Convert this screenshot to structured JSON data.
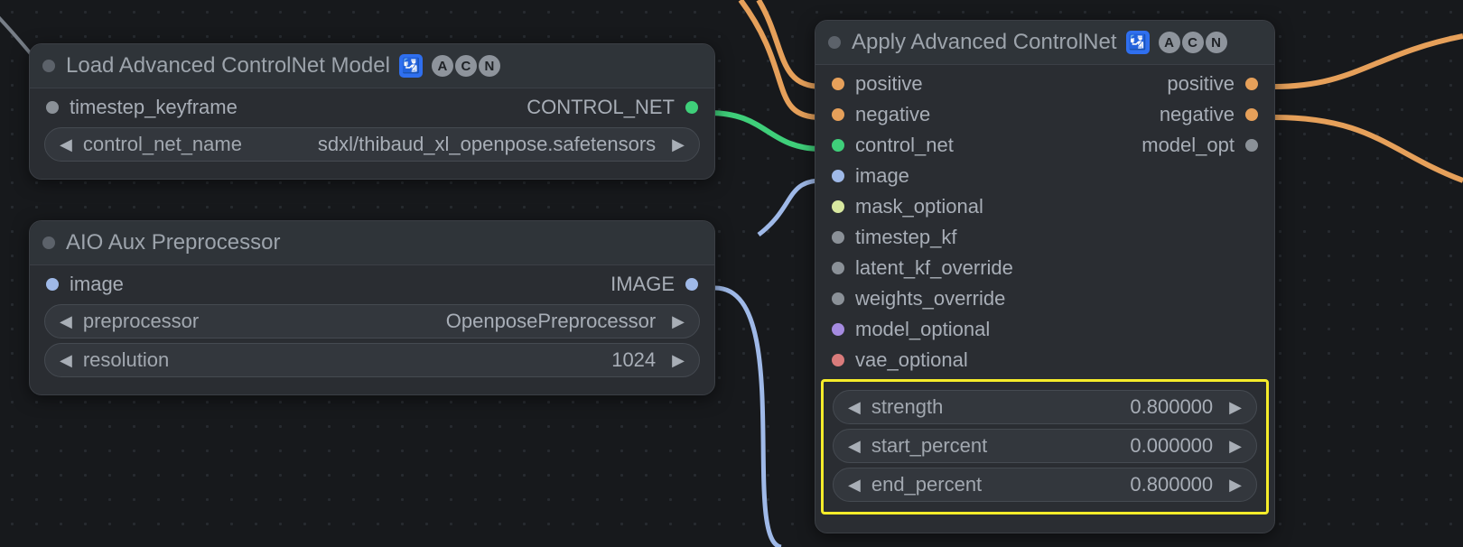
{
  "nodes": {
    "load_acn": {
      "title": "Load Advanced ControlNet Model",
      "badge_glyph": "🛂",
      "acn_letters": [
        "A",
        "C",
        "N"
      ],
      "inputs": {
        "timestep_keyframe": "timestep_keyframe"
      },
      "outputs": {
        "control_net": "CONTROL_NET"
      },
      "params": {
        "control_net_name": {
          "label": "control_net_name",
          "value": "sdxl/thibaud_xl_openpose.safetensors"
        }
      }
    },
    "aio_pre": {
      "title": "AIO Aux Preprocessor",
      "inputs": {
        "image": "image"
      },
      "outputs": {
        "image": "IMAGE"
      },
      "params": {
        "preprocessor": {
          "label": "preprocessor",
          "value": "OpenposePreprocessor"
        },
        "resolution": {
          "label": "resolution",
          "value": "1024"
        }
      }
    },
    "apply_acn": {
      "title": "Apply Advanced ControlNet",
      "badge_glyph": "🛂",
      "acn_letters": [
        "A",
        "C",
        "N"
      ],
      "inputs": {
        "positive": "positive",
        "negative": "negative",
        "control_net": "control_net",
        "image": "image",
        "mask_optional": "mask_optional",
        "timestep_kf": "timestep_kf",
        "latent_kf_override": "latent_kf_override",
        "weights_override": "weights_override",
        "model_optional": "model_optional",
        "vae_optional": "vae_optional"
      },
      "outputs": {
        "positive": "positive",
        "negative": "negative",
        "model_opt": "model_opt"
      },
      "params": {
        "strength": {
          "label": "strength",
          "value": "0.800000"
        },
        "start_percent": {
          "label": "start_percent",
          "value": "0.000000"
        },
        "end_percent": {
          "label": "end_percent",
          "value": "0.800000"
        }
      }
    }
  },
  "colors": {
    "control_net": "#3fcf7a",
    "conditioning": "#e6a05a",
    "image": "#9fb9e8",
    "mask": "#d8e8a0",
    "grey": "#8b9198",
    "model": "#a58be0",
    "vae": "#d97b7b"
  }
}
